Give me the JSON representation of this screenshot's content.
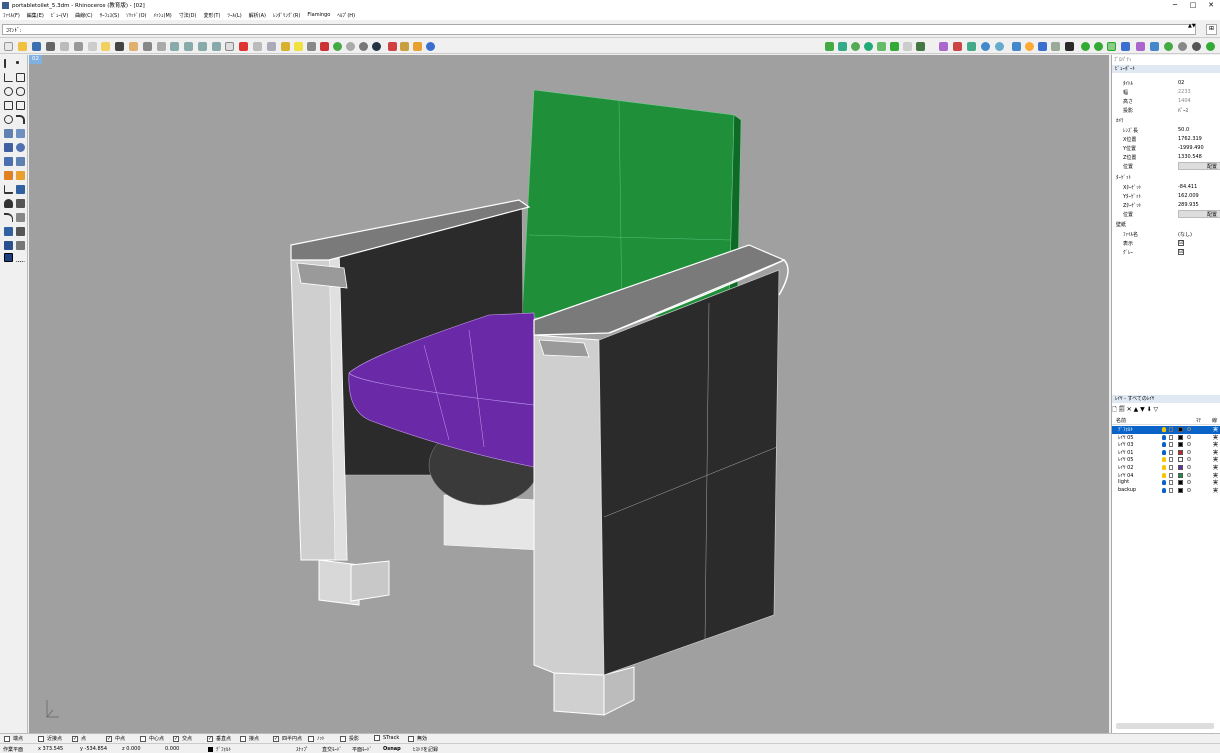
{
  "window": {
    "title": "portabletoilet_5.3dm - Rhinoceros (教育版) - [02]",
    "minimize": "─",
    "maximize": "□",
    "close": "✕"
  },
  "menu": [
    "ﾌｧｲﾙ(F)",
    "編集(E)",
    "ﾋﾞｭｰ(V)",
    "曲線(C)",
    "ｻｰﾌｪｽ(S)",
    "ｿﾘｯﾄﾞ(O)",
    "ﾒｯｼｭ(M)",
    "寸法(D)",
    "変形(T)",
    "ﾂｰﾙ(L)",
    "解析(A)",
    "ﾚﾝﾀﾞﾘﾝｸﾞ(R)",
    "Flamingo",
    "ﾍﾙﾌﾟ(H)"
  ],
  "command": {
    "label": "ｺﾏﾝﾄﾞ:",
    "value": "",
    "button": "⊞",
    "spin": "▲▼"
  },
  "viewport": {
    "label": "02"
  },
  "colors": {
    "green": "#1f8f3a",
    "purple": "#6a2aa8",
    "dark": "#2b2b2b",
    "light": "#d0d0d0",
    "viewport_bg": "#a0a0a0",
    "selection": "#0a64c8"
  },
  "panel": {
    "tabs": "ﾌﾟﾛﾊﾟﾃｨ",
    "viewport_header": "ﾋﾞｭｰﾎﾟｰﾄ",
    "viewport_rows": [
      {
        "k": "ﾀｲﾄﾙ",
        "v": "02",
        "dim": false
      },
      {
        "k": "幅",
        "v": "2233",
        "dim": true
      },
      {
        "k": "高さ",
        "v": "1404",
        "dim": true
      },
      {
        "k": "投影",
        "v": "ﾊﾟｰｽ",
        "dim": false
      }
    ],
    "camera_header": "ｶﾒﾗ",
    "camera_rows": [
      {
        "k": "ﾚﾝｽﾞ長",
        "v": "50.0"
      },
      {
        "k": "X位置",
        "v": "1762.319"
      },
      {
        "k": "Y位置",
        "v": "-1999.490"
      },
      {
        "k": "Z位置",
        "v": "1330.548"
      }
    ],
    "camera_pos": {
      "k": "位置",
      "btn": "配置"
    },
    "target_header": "ﾀｰｹﾞｯﾄ",
    "target_rows": [
      {
        "k": "Xﾀｰｹﾞｯﾄ",
        "v": "-84.411"
      },
      {
        "k": "Yﾀｰｹﾞｯﾄ",
        "v": "162.009"
      },
      {
        "k": "Zﾀｰｹﾞｯﾄ",
        "v": "289.935"
      }
    ],
    "target_pos": {
      "k": "位置",
      "btn": "配置"
    },
    "wallpaper_header": "壁紙",
    "wallpaper_rows": [
      {
        "k": "ﾌｧｲﾙ名",
        "v": "(なし)"
      },
      {
        "k": "表示",
        "check": "☑"
      },
      {
        "k": "ｸﾞﾚｰ",
        "check": "☑"
      }
    ]
  },
  "layers": {
    "header": "ﾚｲﾔ - すべてのﾚｲﾔ",
    "tools": "🗋 🗐 ✕ ▲ ▼ ⬇ ▽",
    "col_name": "名前",
    "col_material": "ﾏﾃ",
    "col_linetype": "線",
    "rows": [
      {
        "name": "ﾃﾞﾌｫﾙﾄ",
        "color": "#000000",
        "bulb": "#f5c400",
        "current": true,
        "linetype": "実"
      },
      {
        "name": "ﾚｲﾔ 05",
        "color": "#000000",
        "bulb": "#0a64c8",
        "current": false,
        "linetype": "実"
      },
      {
        "name": "ﾚｲﾔ 03",
        "color": "#000000",
        "bulb": "#0a64c8",
        "current": false,
        "linetype": "実"
      },
      {
        "name": "ﾚｲﾔ 01",
        "color": "#d02020",
        "bulb": "#0a64c8",
        "current": false,
        "linetype": "実"
      },
      {
        "name": "ﾚｲﾔ 05",
        "color": "#ffffff",
        "bulb": "#f5c400",
        "current": false,
        "linetype": "実"
      },
      {
        "name": "ﾚｲﾔ 02",
        "color": "#6a2aa8",
        "bulb": "#f5c400",
        "current": false,
        "linetype": "実"
      },
      {
        "name": "ﾚｲﾔ 04",
        "color": "#1f8f3a",
        "bulb": "#f5c400",
        "current": false,
        "linetype": "実"
      },
      {
        "name": "light",
        "color": "#000000",
        "bulb": "#0a64c8",
        "current": false,
        "linetype": "実"
      },
      {
        "name": "backup",
        "color": "#000000",
        "bulb": "#0a64c8",
        "current": false,
        "linetype": "実"
      }
    ]
  },
  "osnap": [
    {
      "label": "端点",
      "checked": false
    },
    {
      "label": "近接点",
      "checked": false
    },
    {
      "label": "点",
      "checked": true
    },
    {
      "label": "中点",
      "checked": true
    },
    {
      "label": "中心点",
      "checked": false
    },
    {
      "label": "交点",
      "checked": true
    },
    {
      "label": "垂直点",
      "checked": true
    },
    {
      "label": "接点",
      "checked": false
    },
    {
      "label": "四半円点",
      "checked": true
    },
    {
      "label": "ﾉｯﾄ",
      "checked": false
    },
    {
      "label": "投影",
      "checked": false
    },
    {
      "label": "STrack",
      "checked": false
    },
    {
      "label": "無効",
      "checked": false
    }
  ],
  "status": {
    "plane": "作業平面",
    "x": "x 373.545",
    "y": "y -534.854",
    "z": "z 0.000",
    "dist": "0.000",
    "layer": "ﾃﾞﾌｫﾙﾄ",
    "snap": "ｽﾅｯﾌﾟ",
    "ortho": "直交ﾓｰﾄﾞ",
    "planar": "平面ﾓｰﾄﾞ",
    "osnap": "Osnap",
    "history": "ﾋｽﾄﾘを記録"
  }
}
